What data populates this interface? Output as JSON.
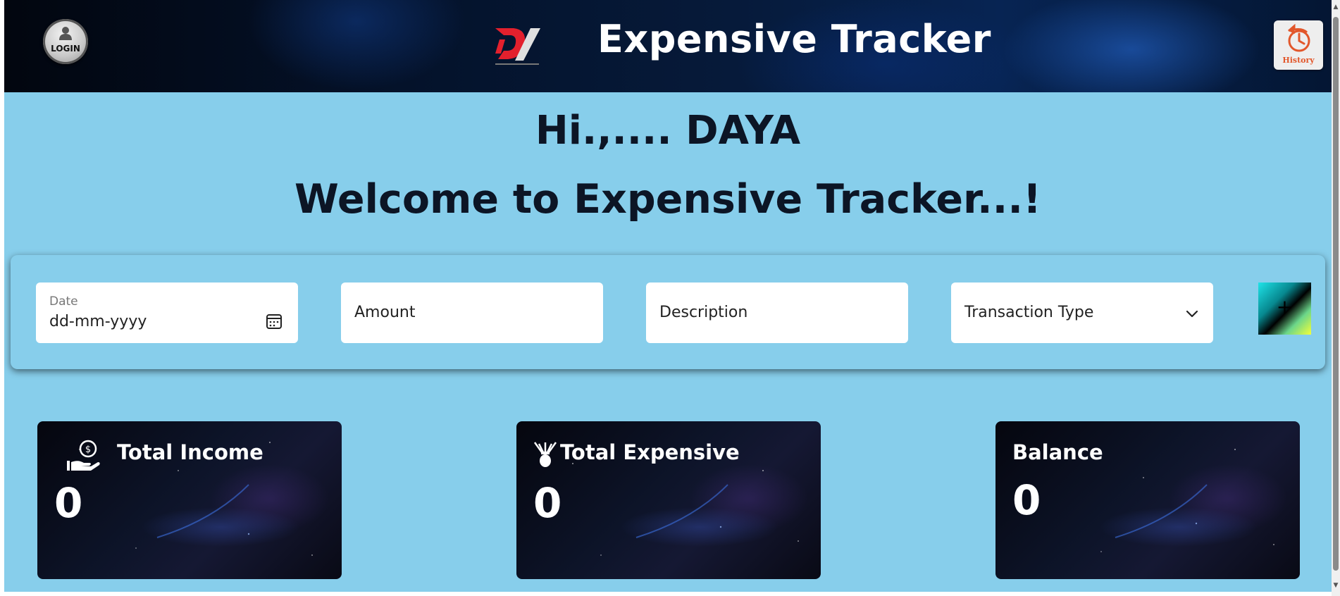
{
  "header": {
    "login_label": "LOGIN",
    "title": "Expensive Tracker",
    "history_label": "History",
    "brand_logo": "DV brand logo"
  },
  "greeting": "Hi.,.... DAYA",
  "welcome": "Welcome to Expensive Tracker...!",
  "form": {
    "date_label": "Date",
    "date_value": "dd-mm-yyyy",
    "amount_placeholder": "Amount",
    "description_placeholder": "Description",
    "transaction_type": "Transaction Type",
    "add_label": "+"
  },
  "cards": {
    "income": {
      "title": "Total Income",
      "value": "0",
      "icon": "money-hand-icon"
    },
    "expense": {
      "title": "Total Expensive",
      "value": "0",
      "icon": "expense-icon"
    },
    "balance": {
      "title": "Balance",
      "value": "0"
    }
  },
  "colors": {
    "page_bg": "#87ceeb",
    "header_bg": "#04122a",
    "text_dark": "#0c1525",
    "history_accent": "#e2572b",
    "logo_red": "#e3202d"
  }
}
